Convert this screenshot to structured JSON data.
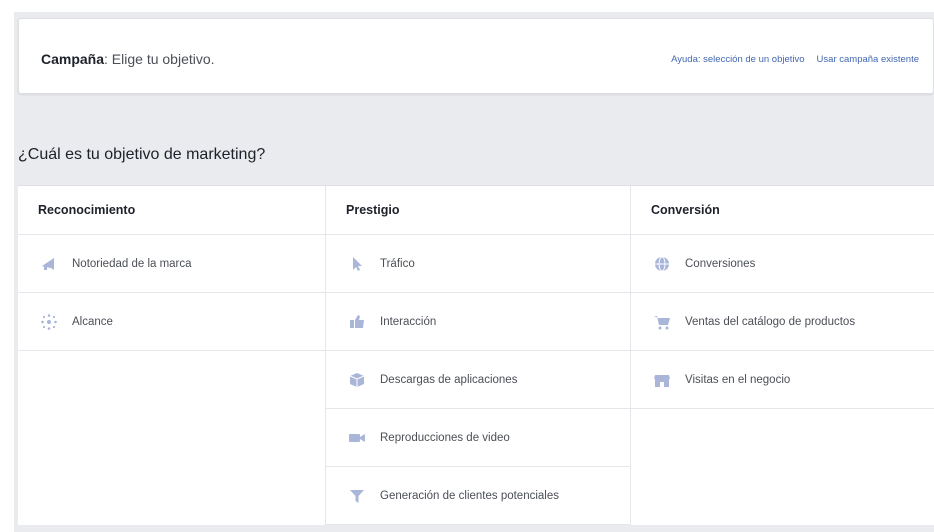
{
  "header": {
    "title_strong": "Campaña",
    "title_rest": ": Elige tu objetivo.",
    "help_link": "Ayuda: selección de un objetivo",
    "existing_link": "Usar campaña existente"
  },
  "question": "¿Cuál es tu objetivo de marketing?",
  "columns": [
    {
      "heading": "Reconocimiento",
      "items": [
        {
          "label": "Notoriedad de la marca",
          "icon": "megaphone-icon"
        },
        {
          "label": "Alcance",
          "icon": "reach-icon"
        }
      ]
    },
    {
      "heading": "Prestigio",
      "items": [
        {
          "label": "Tráfico",
          "icon": "cursor-icon"
        },
        {
          "label": "Interacción",
          "icon": "engagement-icon"
        },
        {
          "label": "Descargas de aplicaciones",
          "icon": "app-box-icon"
        },
        {
          "label": "Reproducciones de video",
          "icon": "video-icon"
        },
        {
          "label": "Generación de clientes potenciales",
          "icon": "funnel-icon"
        }
      ]
    },
    {
      "heading": "Conversión",
      "items": [
        {
          "label": "Conversiones",
          "icon": "globe-icon"
        },
        {
          "label": "Ventas del catálogo de productos",
          "icon": "cart-icon"
        },
        {
          "label": "Visitas en el negocio",
          "icon": "store-icon"
        }
      ]
    }
  ],
  "colors": {
    "link": "#4267b2",
    "icon": "#a9b6d8",
    "background": "#e9ebee"
  }
}
